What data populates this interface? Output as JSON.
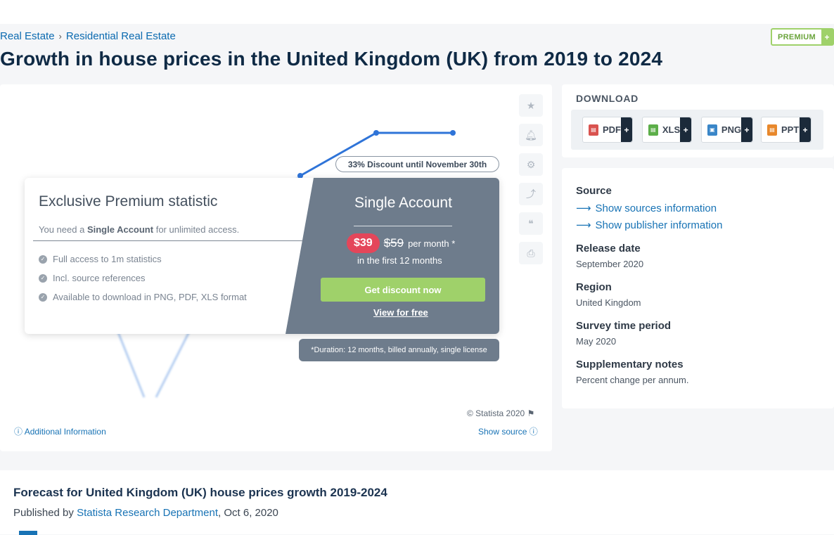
{
  "breadcrumb": {
    "items": [
      "Real Estate",
      "Residential Real Estate"
    ],
    "separator": "›"
  },
  "premium_badge": {
    "label": "PREMIUM",
    "plus": "+"
  },
  "page_title": "Growth in house prices in the United Kingdom (UK) from 2019 to 2024",
  "chart": {
    "copyright": "© Statista 2020",
    "additional_info": "Additional Information",
    "show_source": "Show source",
    "side_buttons": [
      "star-icon",
      "bell-icon",
      "gear-icon",
      "share-icon",
      "quote-icon",
      "print-icon"
    ]
  },
  "paywall": {
    "discount": "33% Discount until November 30th",
    "heading": "Exclusive Premium statistic",
    "need_prefix": "You need a",
    "need_bold": "Single Account",
    "need_suffix": "for unlimited access.",
    "features": [
      "Full access to 1m statistics",
      "Incl. source references",
      "Available to download in PNG, PDF, XLS format"
    ],
    "account": "Single Account",
    "price_now": "$39",
    "price_old": "$59",
    "price_per": "per month *",
    "first12": "in the first 12 months",
    "cta": "Get discount now",
    "view_free": "View for free",
    "duration": "*Duration: 12 months, billed annually, single license"
  },
  "download": {
    "title": "DOWNLOAD",
    "buttons": [
      {
        "label": "PDF",
        "color": "#d9534f"
      },
      {
        "label": "XLS",
        "color": "#5cae49"
      },
      {
        "label": "PNG",
        "color": "#3a86c8"
      },
      {
        "label": "PPT",
        "color": "#e8882c"
      }
    ],
    "plus": "+"
  },
  "details": {
    "source_h": "Source",
    "show_sources": "Show sources information",
    "show_publisher": "Show publisher information",
    "release_h": "Release date",
    "release_v": "September 2020",
    "region_h": "Region",
    "region_v": "United Kingdom",
    "survey_h": "Survey time period",
    "survey_v": "May 2020",
    "supp_h": "Supplementary notes",
    "supp_v": "Percent change per annum."
  },
  "bottom": {
    "title": "Forecast for United Kingdom (UK) house prices growth 2019-2024",
    "published_by": "Published by",
    "publisher": "Statista Research Department",
    "date": ", Oct 6, 2020"
  },
  "colors": {
    "line": "#2f74d8",
    "accent_green": "#9fd16a",
    "link": "#1873b5",
    "badge_red": "#e4465a"
  }
}
